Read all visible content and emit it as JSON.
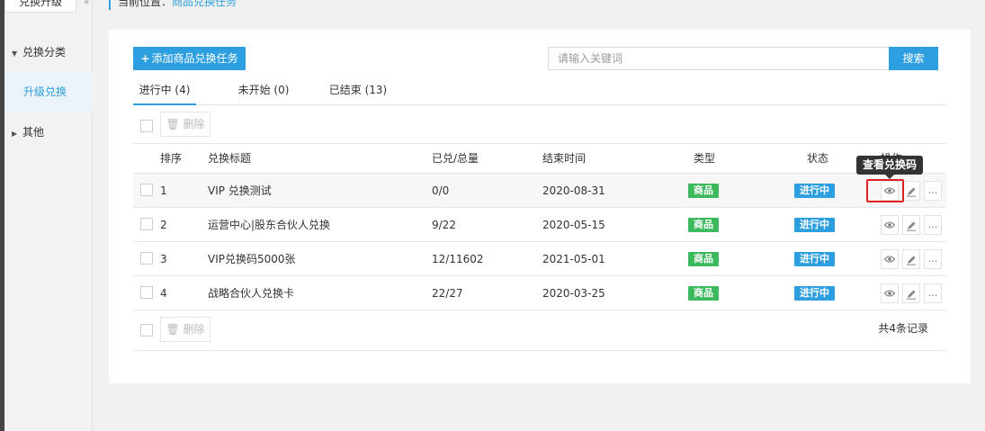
{
  "sidebar": {
    "top_tab": "兑换升级",
    "collapse_icon": "«",
    "groups": [
      {
        "label": "兑换分类",
        "expanded": true
      },
      {
        "label": "其他",
        "expanded": false
      }
    ],
    "active_item": "升级兑换"
  },
  "breadcrumb": {
    "prefix": "当前位置：",
    "current": "商品兑换任务"
  },
  "toolbar": {
    "add_label": "添加商品兑换任务",
    "search_placeholder": "请输入关键词",
    "search_label": "搜索",
    "delete_label": "删除"
  },
  "tabs": [
    {
      "label": "进行中 (4)",
      "active": true
    },
    {
      "label": "未开始 (0)",
      "active": false
    },
    {
      "label": "已结束 (13)",
      "active": false
    }
  ],
  "table": {
    "headers": [
      "排序",
      "兑换标题",
      "已兑/总量",
      "结束时间",
      "类型",
      "状态",
      "操作"
    ],
    "rows": [
      {
        "order": "1",
        "title": "VIP 兑换测试",
        "ratio": "0/0",
        "end": "2020-08-31",
        "type": "商品",
        "status": "进行中"
      },
      {
        "order": "2",
        "title": "运营中心|股东合伙人兑换",
        "ratio": "9/22",
        "end": "2020-05-15",
        "type": "商品",
        "status": "进行中"
      },
      {
        "order": "3",
        "title": "VIP兑换码5000张",
        "ratio": "12/11602",
        "end": "2021-05-01",
        "type": "商品",
        "status": "进行中"
      },
      {
        "order": "4",
        "title": "战略合伙人兑换卡",
        "ratio": "22/27",
        "end": "2020-03-25",
        "type": "商品",
        "status": "进行中"
      }
    ],
    "more_label": "..."
  },
  "tooltip": "查看兑换码",
  "footer": {
    "total": "共4条记录"
  },
  "colors": {
    "accent": "#2d9fe0",
    "green_badge": "#3cb95c",
    "highlight": "#e02020"
  }
}
